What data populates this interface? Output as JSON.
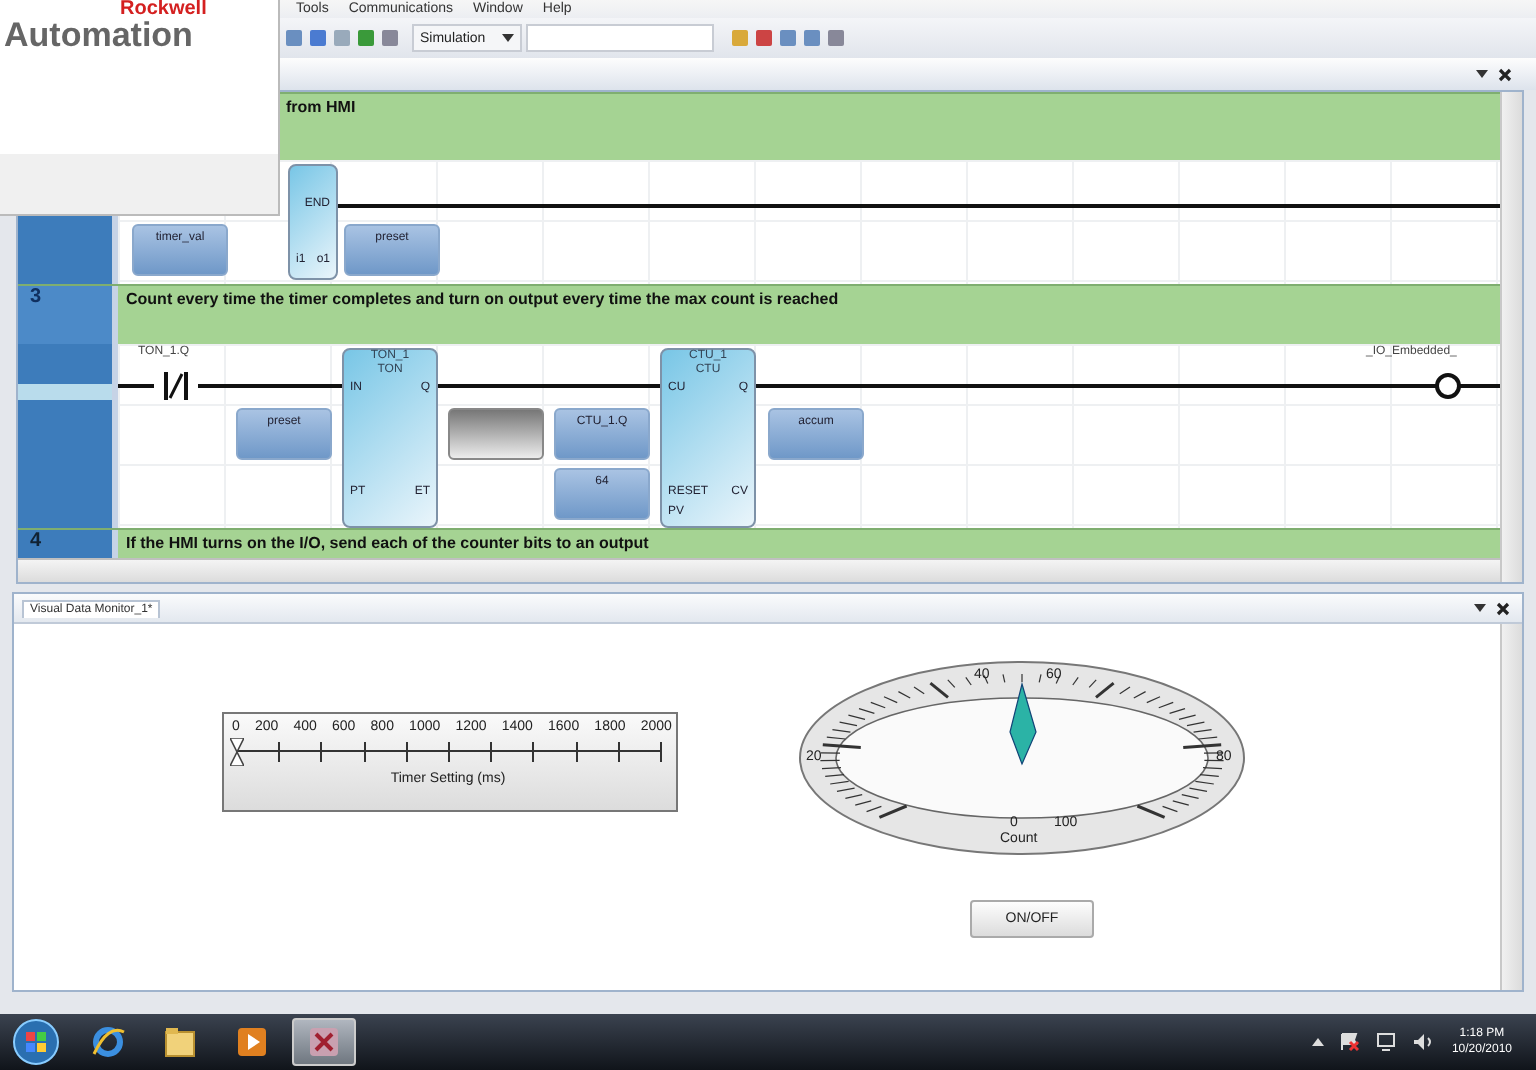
{
  "overlay_logo": {
    "line_1": "Rockwell",
    "line_2": "Automation"
  },
  "menu_bar": [
    {
      "label": "Tools"
    },
    {
      "label": "Communications"
    },
    {
      "label": "Window"
    },
    {
      "label": "Help"
    }
  ],
  "toolbar": {
    "mode_dropdown": "Simulation"
  },
  "editor": {
    "rung_partial": {
      "comment": "from HMI",
      "block": {
        "pins_left": [
          "i1"
        ],
        "pins_right": [
          "END",
          "o1"
        ]
      },
      "tags": [
        "timer_val",
        "preset"
      ]
    },
    "rung_main": {
      "number": "3",
      "comment": "Count every time the timer completes and turn on output every time the max count is reached",
      "contact": {
        "tag": "TON_1.Q",
        "negated": true
      },
      "blocks": [
        {
          "name": "TON_1",
          "type": "TON",
          "pins_left": [
            "IN",
            "PT"
          ],
          "pins_right": [
            "Q",
            "ET"
          ]
        },
        {
          "name": "CTU_1",
          "type": "CTU",
          "pins_left": [
            "CU",
            "RESET",
            "PV"
          ],
          "pins_right": [
            "Q",
            "CV"
          ]
        }
      ],
      "tags": [
        {
          "kind": "tag",
          "label": "preset"
        },
        {
          "kind": "empty"
        },
        {
          "kind": "tag",
          "label": "CTU_1.Q"
        },
        {
          "kind": "tag",
          "label": "64"
        },
        {
          "kind": "tag",
          "label": "accum"
        }
      ],
      "coil": {
        "tag": "_IO_Embedded_"
      }
    },
    "rung_next": {
      "number": "4",
      "comment": "If the HMI turns on the I/O, send each of the counter bits to an output"
    }
  },
  "monitor": {
    "tab": "Visual Data Monitor_1*",
    "slider": {
      "labels": [
        "0",
        "200",
        "400",
        "600",
        "800",
        "1000",
        "1200",
        "1400",
        "1600",
        "1800",
        "2000"
      ],
      "caption": "Timer Setting (ms)",
      "level": 0
    },
    "gauge": {
      "labels": [
        "0",
        "20",
        "40",
        "60",
        "80",
        "100"
      ],
      "caption": "Count",
      "level": 0.5
    },
    "toggle_button": "ON/OFF"
  },
  "taskbar": {
    "apps": [
      {
        "kind": "browser",
        "selected": false
      },
      {
        "kind": "folder",
        "selected": false
      },
      {
        "kind": "media",
        "selected": false
      },
      {
        "kind": "app",
        "selected": true
      }
    ],
    "time": "1:18 PM",
    "date": "10/20/2010"
  }
}
